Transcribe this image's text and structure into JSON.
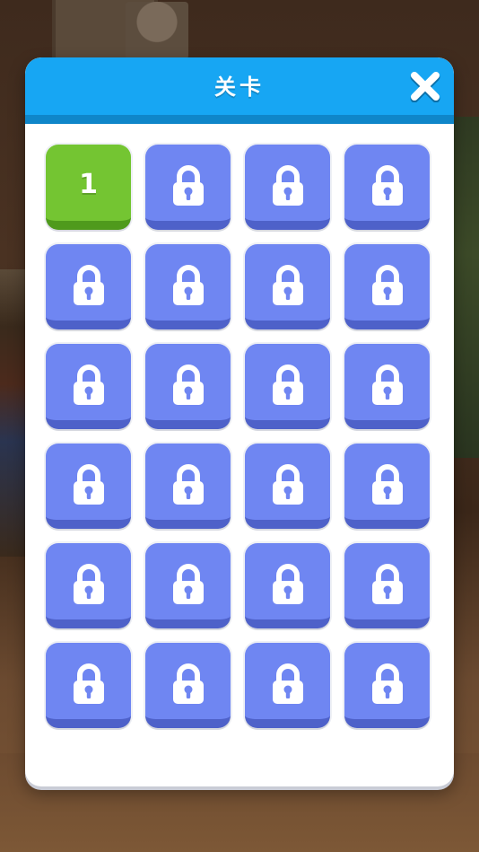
{
  "dialog": {
    "title": "关卡",
    "close_icon": "close-icon"
  },
  "colors": {
    "header": "#17a6f3",
    "unlocked_tile": "#74c532",
    "locked_tile": "#6f86f2"
  },
  "levels": [
    {
      "label": "1",
      "state": "unlocked"
    },
    {
      "label": "",
      "state": "locked",
      "icon": "lock-icon"
    },
    {
      "label": "",
      "state": "locked",
      "icon": "lock-icon"
    },
    {
      "label": "",
      "state": "locked",
      "icon": "lock-icon"
    },
    {
      "label": "",
      "state": "locked",
      "icon": "lock-icon"
    },
    {
      "label": "",
      "state": "locked",
      "icon": "lock-icon"
    },
    {
      "label": "",
      "state": "locked",
      "icon": "lock-icon"
    },
    {
      "label": "",
      "state": "locked",
      "icon": "lock-icon"
    },
    {
      "label": "",
      "state": "locked",
      "icon": "lock-icon"
    },
    {
      "label": "",
      "state": "locked",
      "icon": "lock-icon"
    },
    {
      "label": "",
      "state": "locked",
      "icon": "lock-icon"
    },
    {
      "label": "",
      "state": "locked",
      "icon": "lock-icon"
    },
    {
      "label": "",
      "state": "locked",
      "icon": "lock-icon"
    },
    {
      "label": "",
      "state": "locked",
      "icon": "lock-icon"
    },
    {
      "label": "",
      "state": "locked",
      "icon": "lock-icon"
    },
    {
      "label": "",
      "state": "locked",
      "icon": "lock-icon"
    },
    {
      "label": "",
      "state": "locked",
      "icon": "lock-icon"
    },
    {
      "label": "",
      "state": "locked",
      "icon": "lock-icon"
    },
    {
      "label": "",
      "state": "locked",
      "icon": "lock-icon"
    },
    {
      "label": "",
      "state": "locked",
      "icon": "lock-icon"
    },
    {
      "label": "",
      "state": "locked",
      "icon": "lock-icon"
    },
    {
      "label": "",
      "state": "locked",
      "icon": "lock-icon"
    },
    {
      "label": "",
      "state": "locked",
      "icon": "lock-icon"
    },
    {
      "label": "",
      "state": "locked",
      "icon": "lock-icon"
    }
  ]
}
